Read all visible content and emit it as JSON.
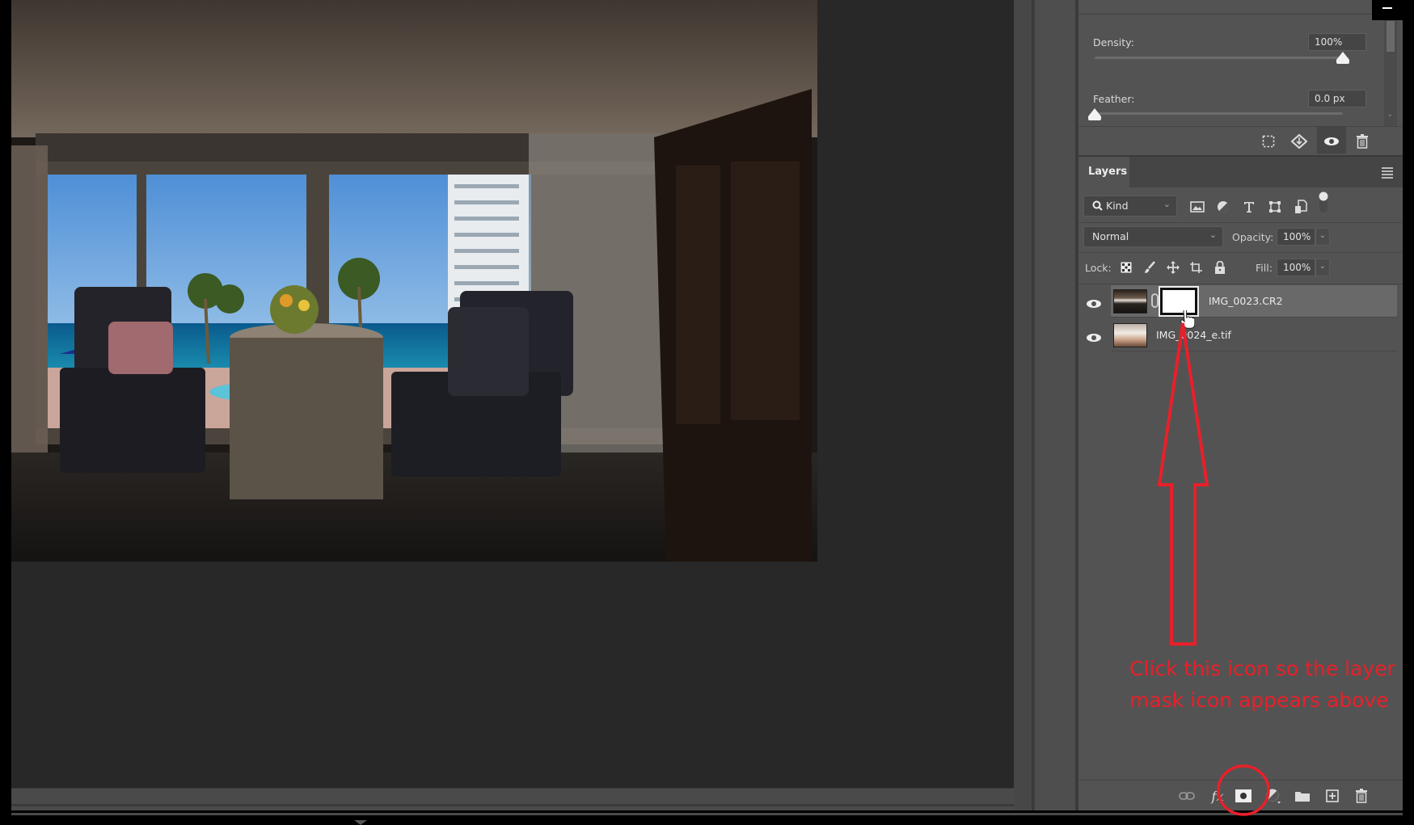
{
  "window": {
    "minimize_label": "Minimize"
  },
  "canvas": {
    "image_description": "Hotel room interior with two armchairs, a round table with flowers, and a window view of ocean, pool and palm trees"
  },
  "properties": {
    "density": {
      "label": "Density:",
      "value": "100%",
      "fraction": 1.0
    },
    "feather": {
      "label": "Feather:",
      "value": "0.0 px",
      "fraction": 0.0
    },
    "toolbar_icons": [
      "selection-from-mask-icon",
      "apply-mask-icon",
      "visibility-eye-icon",
      "delete-mask-icon"
    ]
  },
  "layers_panel": {
    "tab_label": "Layers",
    "filter": {
      "label": "Kind",
      "icons": [
        "pixel-filter-icon",
        "adjustment-filter-icon",
        "type-filter-icon",
        "shape-filter-icon",
        "smart-object-filter-icon",
        "filter-toggle-icon"
      ]
    },
    "blend_mode": "Normal",
    "opacity": {
      "label": "Opacity:",
      "value": "100%"
    },
    "lock": {
      "label": "Lock:",
      "icons": [
        "lock-transparent-icon",
        "lock-image-icon",
        "lock-position-icon",
        "lock-artboard-icon",
        "lock-all-icon"
      ]
    },
    "fill": {
      "label": "Fill:",
      "value": "100%"
    },
    "layers": [
      {
        "name": "IMG_0023.CR2",
        "visible": true,
        "selected": true,
        "has_mask": true
      },
      {
        "name": "IMG_0024_e.tif",
        "visible": true,
        "selected": false,
        "has_mask": false
      }
    ],
    "footer_icons": [
      "link-layers-icon",
      "fx-icon",
      "add-layer-mask-icon",
      "adjustment-layer-icon",
      "new-group-icon",
      "new-layer-icon",
      "delete-layer-icon"
    ]
  },
  "annotation": {
    "text": "Click this icon so the layer mask icon appears above",
    "color": "#e8202a"
  }
}
